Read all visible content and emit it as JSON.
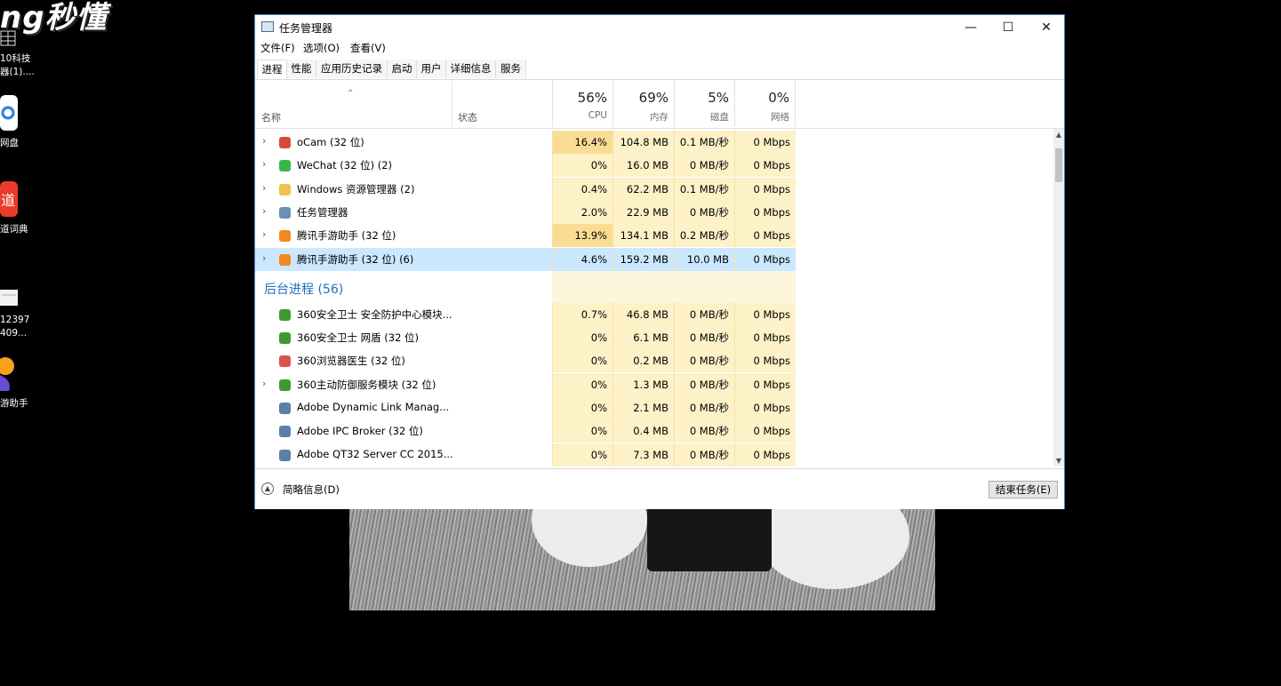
{
  "desktop": {
    "logo_text": "ng秒懂",
    "icons": [
      {
        "label": "10科技\n器(1)....",
        "icon": "grid-icon"
      },
      {
        "label": "网盘",
        "icon": "baidu-netdisk-icon"
      },
      {
        "label": "道词典",
        "icon": "youdao-dict-icon"
      },
      {
        "label": "12397\n409...",
        "icon": "document-icon"
      },
      {
        "label": "游助手",
        "icon": "tencent-game-helper-icon"
      }
    ]
  },
  "window": {
    "title": "任务管理器",
    "controls": {
      "minimize": "—",
      "maximize": "☐",
      "close": "✕"
    },
    "menu": [
      "文件(F)",
      "选项(O)",
      "查看(V)"
    ],
    "tabs": [
      "进程",
      "性能",
      "应用历史记录",
      "启动",
      "用户",
      "详细信息",
      "服务"
    ],
    "active_tab": "进程",
    "columns": {
      "name": "名称",
      "status": "状态",
      "cpu": {
        "pct": "56%",
        "label": "CPU"
      },
      "mem": {
        "pct": "69%",
        "label": "内存"
      },
      "disk": {
        "pct": "5%",
        "label": "磁盘"
      },
      "net": {
        "pct": "0%",
        "label": "网络"
      }
    },
    "apps": [
      {
        "name": "oCam (32 位)",
        "cpu": "16.4%",
        "mem": "104.8 MB",
        "disk": "0.1 MB/秒",
        "net": "0 Mbps",
        "expand": true,
        "icon": "ocam-icon",
        "color": "#d94a3a"
      },
      {
        "name": "WeChat (32 位) (2)",
        "cpu": "0%",
        "mem": "16.0 MB",
        "disk": "0 MB/秒",
        "net": "0 Mbps",
        "expand": true,
        "icon": "wechat-icon",
        "color": "#3bb54a"
      },
      {
        "name": "Windows 资源管理器 (2)",
        "cpu": "0.4%",
        "mem": "62.2 MB",
        "disk": "0.1 MB/秒",
        "net": "0 Mbps",
        "expand": true,
        "icon": "folder-icon",
        "color": "#f0c24a"
      },
      {
        "name": "任务管理器",
        "cpu": "2.0%",
        "mem": "22.9 MB",
        "disk": "0 MB/秒",
        "net": "0 Mbps",
        "expand": true,
        "icon": "task-manager-icon",
        "color": "#6b8fb5"
      },
      {
        "name": "腾讯手游助手 (32 位)",
        "cpu": "13.9%",
        "mem": "134.1 MB",
        "disk": "0.2 MB/秒",
        "net": "0 Mbps",
        "expand": true,
        "icon": "tencent-game-helper-icon",
        "color": "#f08a1e"
      },
      {
        "name": "腾讯手游助手 (32 位) (6)",
        "cpu": "4.6%",
        "mem": "159.2 MB",
        "disk": "10.0 MB",
        "net": "0 Mbps",
        "expand": true,
        "icon": "tencent-game-helper-icon",
        "color": "#f08a1e",
        "selected": true
      }
    ],
    "group_label": "后台进程 (56)",
    "background": [
      {
        "name": "360安全卫士 安全防护中心模块...",
        "cpu": "0.7%",
        "mem": "46.8 MB",
        "disk": "0 MB/秒",
        "net": "0 Mbps",
        "expand": false,
        "icon": "360-security-icon",
        "color": "#3d9b2f"
      },
      {
        "name": "360安全卫士 网盾 (32 位)",
        "cpu": "0%",
        "mem": "6.1 MB",
        "disk": "0 MB/秒",
        "net": "0 Mbps",
        "expand": false,
        "icon": "360-shield-icon",
        "color": "#3d9b2f"
      },
      {
        "name": "360浏览器医生 (32 位)",
        "cpu": "0%",
        "mem": "0.2 MB",
        "disk": "0 MB/秒",
        "net": "0 Mbps",
        "expand": false,
        "icon": "360-browser-doctor-icon",
        "color": "#d9534f"
      },
      {
        "name": "360主动防御服务模块 (32 位)",
        "cpu": "0%",
        "mem": "1.3 MB",
        "disk": "0 MB/秒",
        "net": "0 Mbps",
        "expand": true,
        "icon": "360-defense-icon",
        "color": "#3d9b2f"
      },
      {
        "name": "Adobe Dynamic Link Manag...",
        "cpu": "0%",
        "mem": "2.1 MB",
        "disk": "0 MB/秒",
        "net": "0 Mbps",
        "expand": false,
        "icon": "app-window-icon",
        "color": "#5a7fa8"
      },
      {
        "name": "Adobe IPC Broker (32 位)",
        "cpu": "0%",
        "mem": "0.4 MB",
        "disk": "0 MB/秒",
        "net": "0 Mbps",
        "expand": false,
        "icon": "app-window-icon",
        "color": "#5a7fa8"
      },
      {
        "name": "Adobe QT32 Server CC 2015...",
        "cpu": "0%",
        "mem": "7.3 MB",
        "disk": "0 MB/秒",
        "net": "0 Mbps",
        "expand": false,
        "icon": "app-window-icon",
        "color": "#5a7fa8"
      }
    ],
    "footer": {
      "less_details": "简略信息(D)",
      "end_task": "结束任务(E)"
    }
  }
}
